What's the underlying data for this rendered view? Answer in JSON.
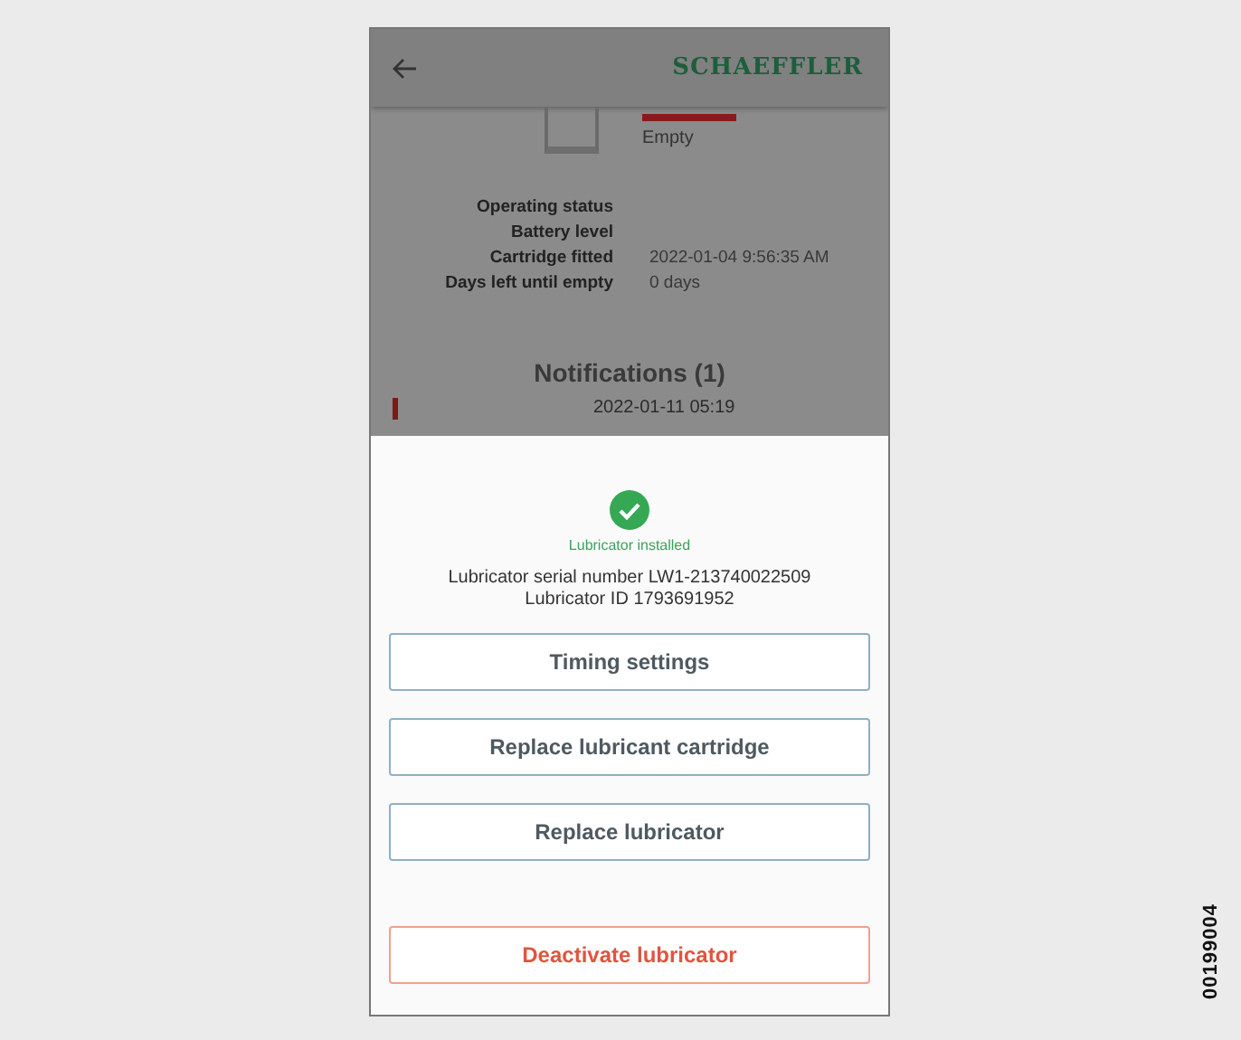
{
  "header": {
    "logo": "SCHAEFFLER"
  },
  "cartridge": {
    "status": "Empty"
  },
  "details": [
    {
      "label": "Operating status"
    },
    {
      "label": "Battery level"
    },
    {
      "label": "Cartridge fitted",
      "value": "2022-01-04 9:56:35 AM"
    },
    {
      "label": "Days left until empty",
      "value": "0 days"
    }
  ],
  "notifications": {
    "title": "Notifications (1)",
    "items": [
      {
        "time": "2022-01-11 05:19"
      }
    ]
  },
  "sheet": {
    "status": "Lubricator installed",
    "serial": "Lubricator serial number LW1-213740022509",
    "id": "Lubricator ID 1793691952",
    "buttons": [
      {
        "label": "Timing settings",
        "kind": "default"
      },
      {
        "label": "Replace lubricant cartridge",
        "kind": "default"
      },
      {
        "label": "Replace lubricator",
        "kind": "default"
      },
      {
        "label": "Deactivate lubricator",
        "kind": "danger"
      }
    ]
  },
  "figure_code": "00199004"
}
